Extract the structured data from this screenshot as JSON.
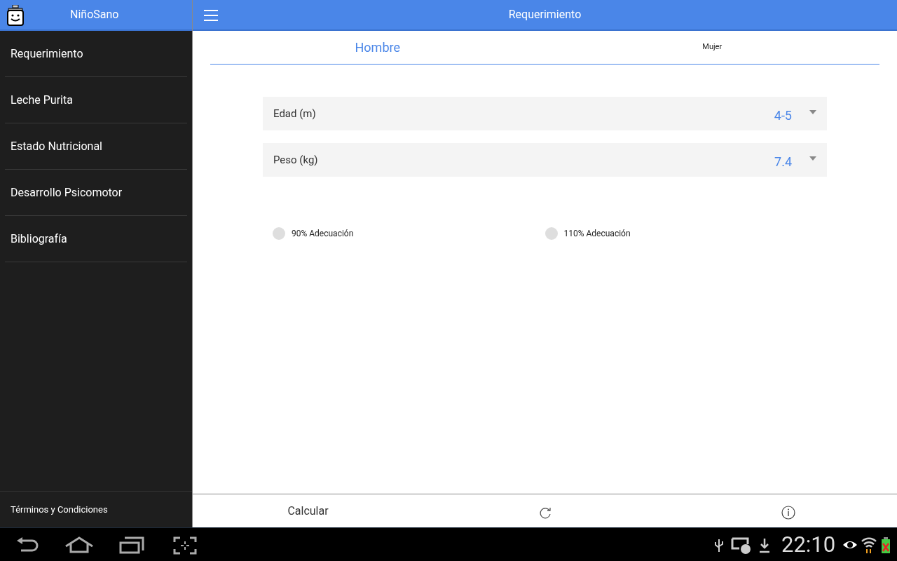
{
  "sidebar": {
    "title": "NiñoSano",
    "items": [
      "Requerimiento",
      "Leche Purita",
      "Estado Nutricional",
      "Desarrollo Psicomotor",
      "Bibliografía"
    ],
    "footer": "Términos y Condiciones"
  },
  "header": {
    "title": "Requerimiento"
  },
  "tabs": [
    {
      "label": "Hombre",
      "selected": true
    },
    {
      "label": "Mujer",
      "selected": false
    }
  ],
  "fields": [
    {
      "label": "Edad (m)",
      "value": "4-5"
    },
    {
      "label": "Peso (kg)",
      "value": "7.4"
    }
  ],
  "radios": [
    {
      "label": "90% Adecuación",
      "checked": false
    },
    {
      "label": "110% Adecuación",
      "checked": false
    }
  ],
  "actions": {
    "calculate": "Calcular"
  },
  "system_bar": {
    "time": "22:10"
  }
}
